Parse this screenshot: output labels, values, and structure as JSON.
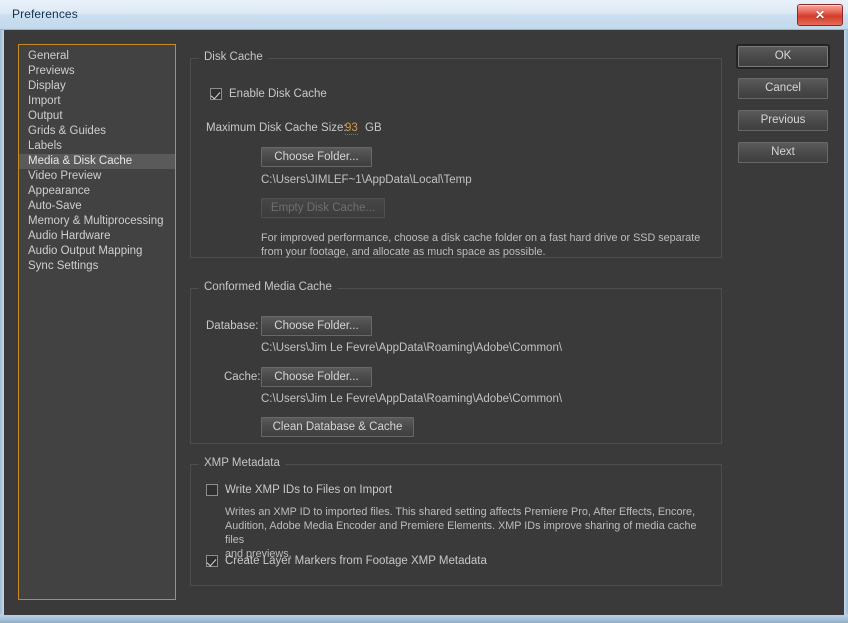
{
  "window": {
    "title": "Preferences",
    "close_glyph": "✕"
  },
  "sidebar": {
    "items": [
      {
        "label": "General",
        "selected": false
      },
      {
        "label": "Previews",
        "selected": false
      },
      {
        "label": "Display",
        "selected": false
      },
      {
        "label": "Import",
        "selected": false
      },
      {
        "label": "Output",
        "selected": false
      },
      {
        "label": "Grids & Guides",
        "selected": false
      },
      {
        "label": "Labels",
        "selected": false
      },
      {
        "label": "Media & Disk Cache",
        "selected": true
      },
      {
        "label": "Video Preview",
        "selected": false
      },
      {
        "label": "Appearance",
        "selected": false
      },
      {
        "label": "Auto-Save",
        "selected": false
      },
      {
        "label": "Memory & Multiprocessing",
        "selected": false
      },
      {
        "label": "Audio Hardware",
        "selected": false
      },
      {
        "label": "Audio Output Mapping",
        "selected": false
      },
      {
        "label": "Sync Settings",
        "selected": false
      }
    ]
  },
  "disk_cache": {
    "group_label": "Disk Cache",
    "enable_label": "Enable Disk Cache",
    "enable_checked": true,
    "max_size_label": "Maximum Disk Cache Size:",
    "max_size_value": "93",
    "max_size_unit": "GB",
    "choose_folder_label": "Choose Folder...",
    "folder_path": "C:\\Users\\JIMLEF~1\\AppData\\Local\\Temp",
    "empty_cache_label": "Empty Disk Cache...",
    "empty_cache_enabled": false,
    "description_line1": "For improved performance, choose a disk cache folder on a fast hard drive or SSD separate",
    "description_line2": "from your footage, and allocate as much space as possible."
  },
  "conformed_media_cache": {
    "group_label": "Conformed Media Cache",
    "database_label": "Database:",
    "database_button": "Choose Folder...",
    "database_path": "C:\\Users\\Jim Le Fevre\\AppData\\Roaming\\Adobe\\Common\\",
    "cache_label": "Cache:",
    "cache_button": "Choose Folder...",
    "cache_path": "C:\\Users\\Jim Le Fevre\\AppData\\Roaming\\Adobe\\Common\\",
    "clean_button": "Clean Database & Cache"
  },
  "xmp_metadata": {
    "group_label": "XMP Metadata",
    "write_ids_label": "Write XMP IDs to Files on Import",
    "write_ids_checked": false,
    "description_line1": "Writes an XMP ID to imported files. This shared setting affects Premiere Pro, After Effects, Encore,",
    "description_line2": "Audition, Adobe Media Encoder and Premiere Elements. XMP IDs improve sharing of media cache files",
    "description_line3": "and previews.",
    "create_markers_label": "Create Layer Markers from Footage XMP Metadata",
    "create_markers_checked": true
  },
  "actions": {
    "ok": "OK",
    "cancel": "Cancel",
    "previous": "Previous",
    "next": "Next"
  },
  "colors": {
    "accent_scrub": "#d09a4c",
    "focus_border": "#c98a21",
    "panel_bg": "#3a3a3a",
    "titlebar": "#dce9f5",
    "close_red": "#d43c2c"
  }
}
